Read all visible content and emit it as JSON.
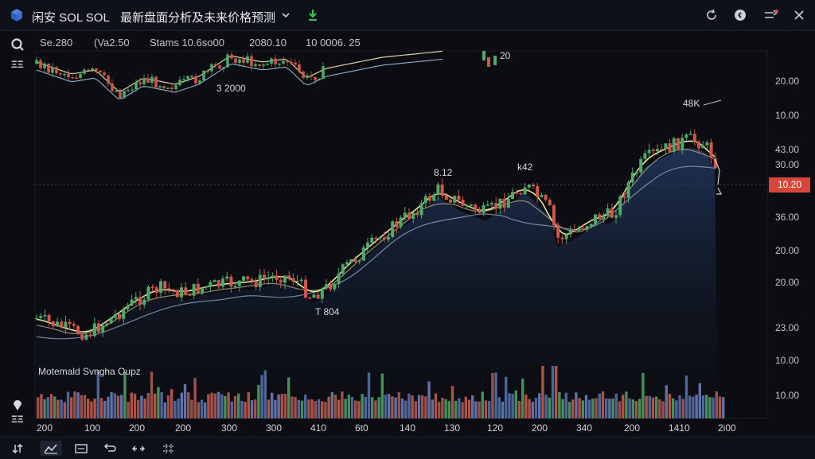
{
  "header": {
    "app_name": "闲安 SOL SOL",
    "page_title": "最新盘面分析及未来价格预测"
  },
  "stats": [
    "Se.280",
    "(Va2.50",
    "Stams 10.6so00",
    "2080.10",
    "10 0006. 25"
  ],
  "left_labels": {
    "top": "ΞΞ",
    "bottom": "ΞΞ"
  },
  "annotations": {
    "peak_1": "8.12",
    "peak_2": "k42",
    "peak_3": "48K",
    "upper_note": "3 2000",
    "low_note": "T 804",
    "top_mini": "20",
    "volume_title": "Motemald Svngha Oupz"
  },
  "y_axis": [
    "20.00",
    "10.00",
    "43.00",
    "30.00",
    "36.00",
    "20.00",
    "20.00",
    "23.00",
    "10.00",
    "10.00"
  ],
  "current_price": "10.20",
  "x_axis": [
    "200",
    "100",
    "200",
    "200",
    "300",
    "300",
    "410",
    "6t0",
    "140",
    "130",
    "120",
    "200",
    "340",
    "200",
    "1410",
    "2i00"
  ],
  "colors": {
    "background": "#0b0d12",
    "up": "#4ea96a",
    "down": "#d0554a",
    "ma_fast": "#e8e2a0",
    "ma_slow": "#8a9bb6",
    "price_tag": "#d7453b"
  },
  "icons": [
    "logo-cube-icon",
    "chevron-down-icon",
    "download-icon",
    "refresh-icon",
    "info-icon",
    "settings-icon",
    "search-icon",
    "pin-icon"
  ],
  "bottom_tools": [
    "candles-icon",
    "chart-icon",
    "replay-icon",
    "compare-icon",
    "grid-icon"
  ]
}
